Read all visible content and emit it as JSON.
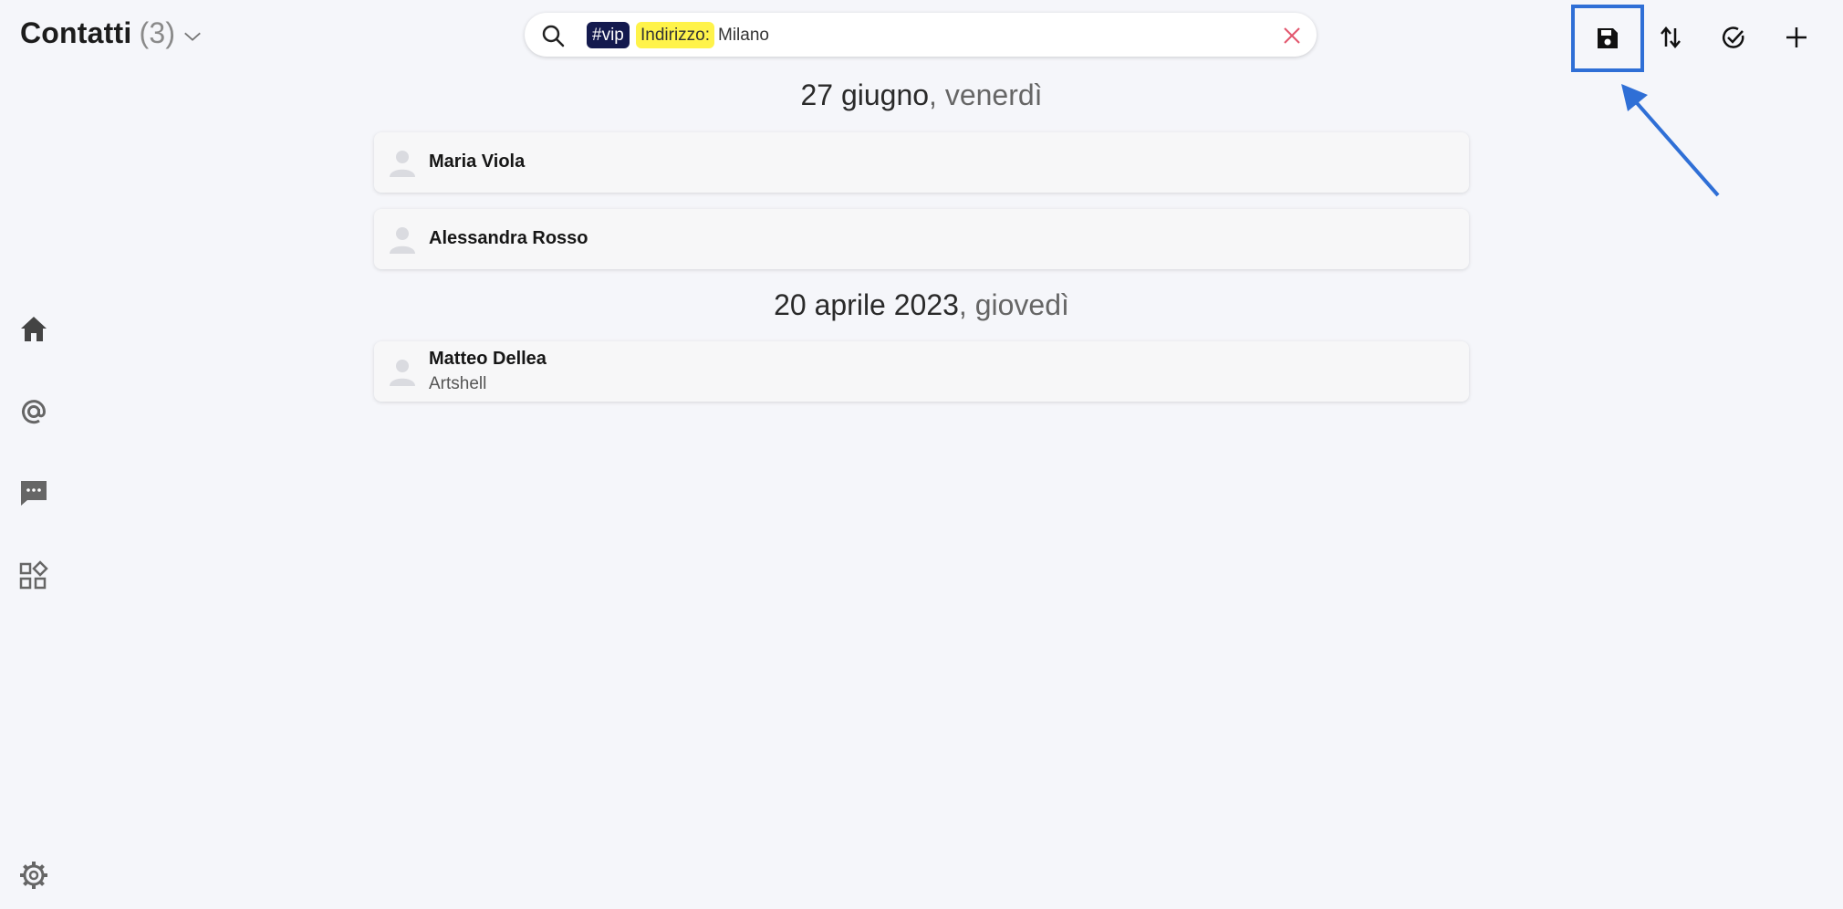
{
  "header": {
    "title": "Contatti",
    "count": "(3)"
  },
  "search": {
    "tag_vip": "#vip",
    "tag_address_label": "Indirizzo:",
    "tag_address_value": "Milano"
  },
  "toolbar": {
    "save_icon": "save-icon",
    "sort_icon": "sort-icon",
    "check_icon": "check-circle-icon",
    "add_icon": "plus-icon"
  },
  "sidebar": {
    "items": [
      {
        "icon": "home-icon"
      },
      {
        "icon": "at-icon"
      },
      {
        "icon": "chat-icon"
      },
      {
        "icon": "apps-icon"
      }
    ],
    "bottom_icon": "gear-icon"
  },
  "groups": [
    {
      "date": "27 giugno",
      "weekday": ", venerdì",
      "contacts": [
        {
          "name": "Maria Viola",
          "company": ""
        },
        {
          "name": "Alessandra Rosso",
          "company": ""
        }
      ]
    },
    {
      "date": "20 aprile 2023",
      "weekday": ", giovedì",
      "contacts": [
        {
          "name": "Matteo Dellea",
          "company": "Artshell"
        }
      ]
    }
  ],
  "colors": {
    "accent": "#2f6fd6",
    "vip_tag_bg": "#141a4e",
    "address_tag_bg": "#fff34a",
    "clear_icon": "#e2566d",
    "background": "#f5f6fa"
  }
}
